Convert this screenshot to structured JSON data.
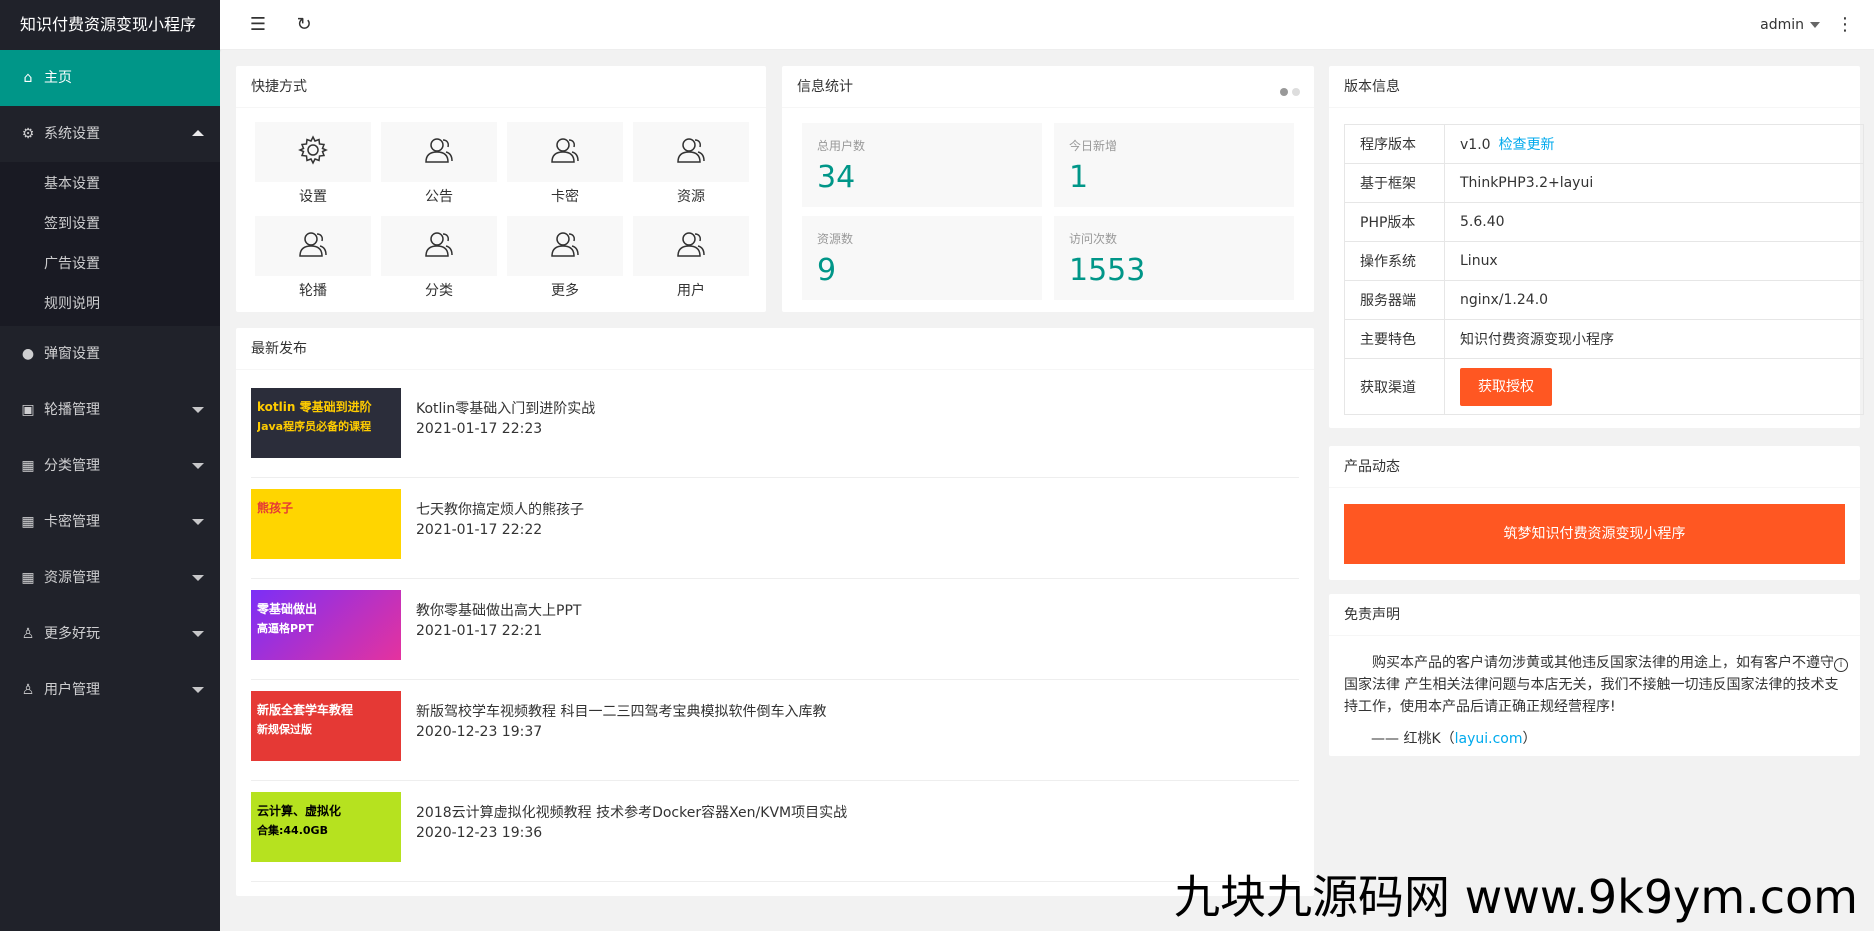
{
  "app_title": "知识付费资源变现小程序",
  "sidebar": {
    "home": "主页",
    "system": {
      "label": "系统设置",
      "children": [
        "基本设置",
        "签到设置",
        "广告设置",
        "规则说明"
      ]
    },
    "popup": "弹窗设置",
    "carousel": "轮播管理",
    "category": "分类管理",
    "card": "卡密管理",
    "resource": "资源管理",
    "more": "更多好玩",
    "user": "用户管理"
  },
  "header": {
    "user": "admin"
  },
  "shortcuts": {
    "title": "快捷方式",
    "items": [
      "设置",
      "公告",
      "卡密",
      "资源",
      "轮播",
      "分类",
      "更多",
      "用户"
    ]
  },
  "stats": {
    "title": "信息统计",
    "items": [
      {
        "label": "总用户数",
        "value": "34"
      },
      {
        "label": "今日新增",
        "value": "1"
      },
      {
        "label": "资源数",
        "value": "9"
      },
      {
        "label": "访问次数",
        "value": "1553"
      }
    ]
  },
  "version": {
    "title": "版本信息",
    "rows": [
      {
        "k": "程序版本",
        "v": "v1.0"
      },
      {
        "k": "基于框架",
        "v": "ThinkPHP3.2+layui"
      },
      {
        "k": "PHP版本",
        "v": "5.6.40"
      },
      {
        "k": "操作系统",
        "v": "Linux"
      },
      {
        "k": "服务器端",
        "v": "nginx/1.24.0"
      },
      {
        "k": "主要特色",
        "v": "知识付费资源变现小程序"
      },
      {
        "k": "获取渠道",
        "v": ""
      }
    ],
    "check_update": "检查更新",
    "get_license": "获取授权"
  },
  "product": {
    "title": "产品动态",
    "banner": "筑梦知识付费资源变现小程序"
  },
  "disclaimer": {
    "title": "免责声明",
    "text": "购买本产品的客户请勿涉黄或其他违反国家法律的用途上，如有客户不遵守国家法律 产生相关法律问题与本店无关，我们不接触一切违反国家法律的技术支持工作，使用本产品后请正确正规经营程序!",
    "sig_prefix": "—— 红桃K（",
    "sig_link": "layui.com",
    "sig_suffix": "）"
  },
  "latest": {
    "title": "最新发布",
    "posts": [
      {
        "title": "Kotlin零基础入门到进阶实战",
        "date": "2021-01-17 22:23",
        "thumb_text": "kotlin 零基础到进阶",
        "thumb_sub": "Java程序员必备的课程"
      },
      {
        "title": "七天教你搞定烦人的熊孩子",
        "date": "2021-01-17 22:22",
        "thumb_text": "熊孩子",
        "thumb_sub": ""
      },
      {
        "title": "教你零基础做出高大上PPT",
        "date": "2021-01-17 22:21",
        "thumb_text": "零基础做出",
        "thumb_sub": "高逼格PPT"
      },
      {
        "title": "新版驾校学车视频教程 科目一二三四驾考宝典模拟软件倒车入库教",
        "date": "2020-12-23 19:37",
        "thumb_text": "新版全套学车教程",
        "thumb_sub": "新规保过版"
      },
      {
        "title": "2018云计算虚拟化视频教程 技术参考Docker容器Xen/KVM项目实战",
        "date": "2020-12-23 19:36",
        "thumb_text": "云计算、虚拟化",
        "thumb_sub": "合集:44.0GB"
      }
    ]
  },
  "watermark": "九块九源码网 www.9k9ym.com",
  "colors": {
    "accent": "#009688",
    "orange": "#ff5722",
    "sidebar": "#20222a",
    "link": "#01aaed"
  }
}
